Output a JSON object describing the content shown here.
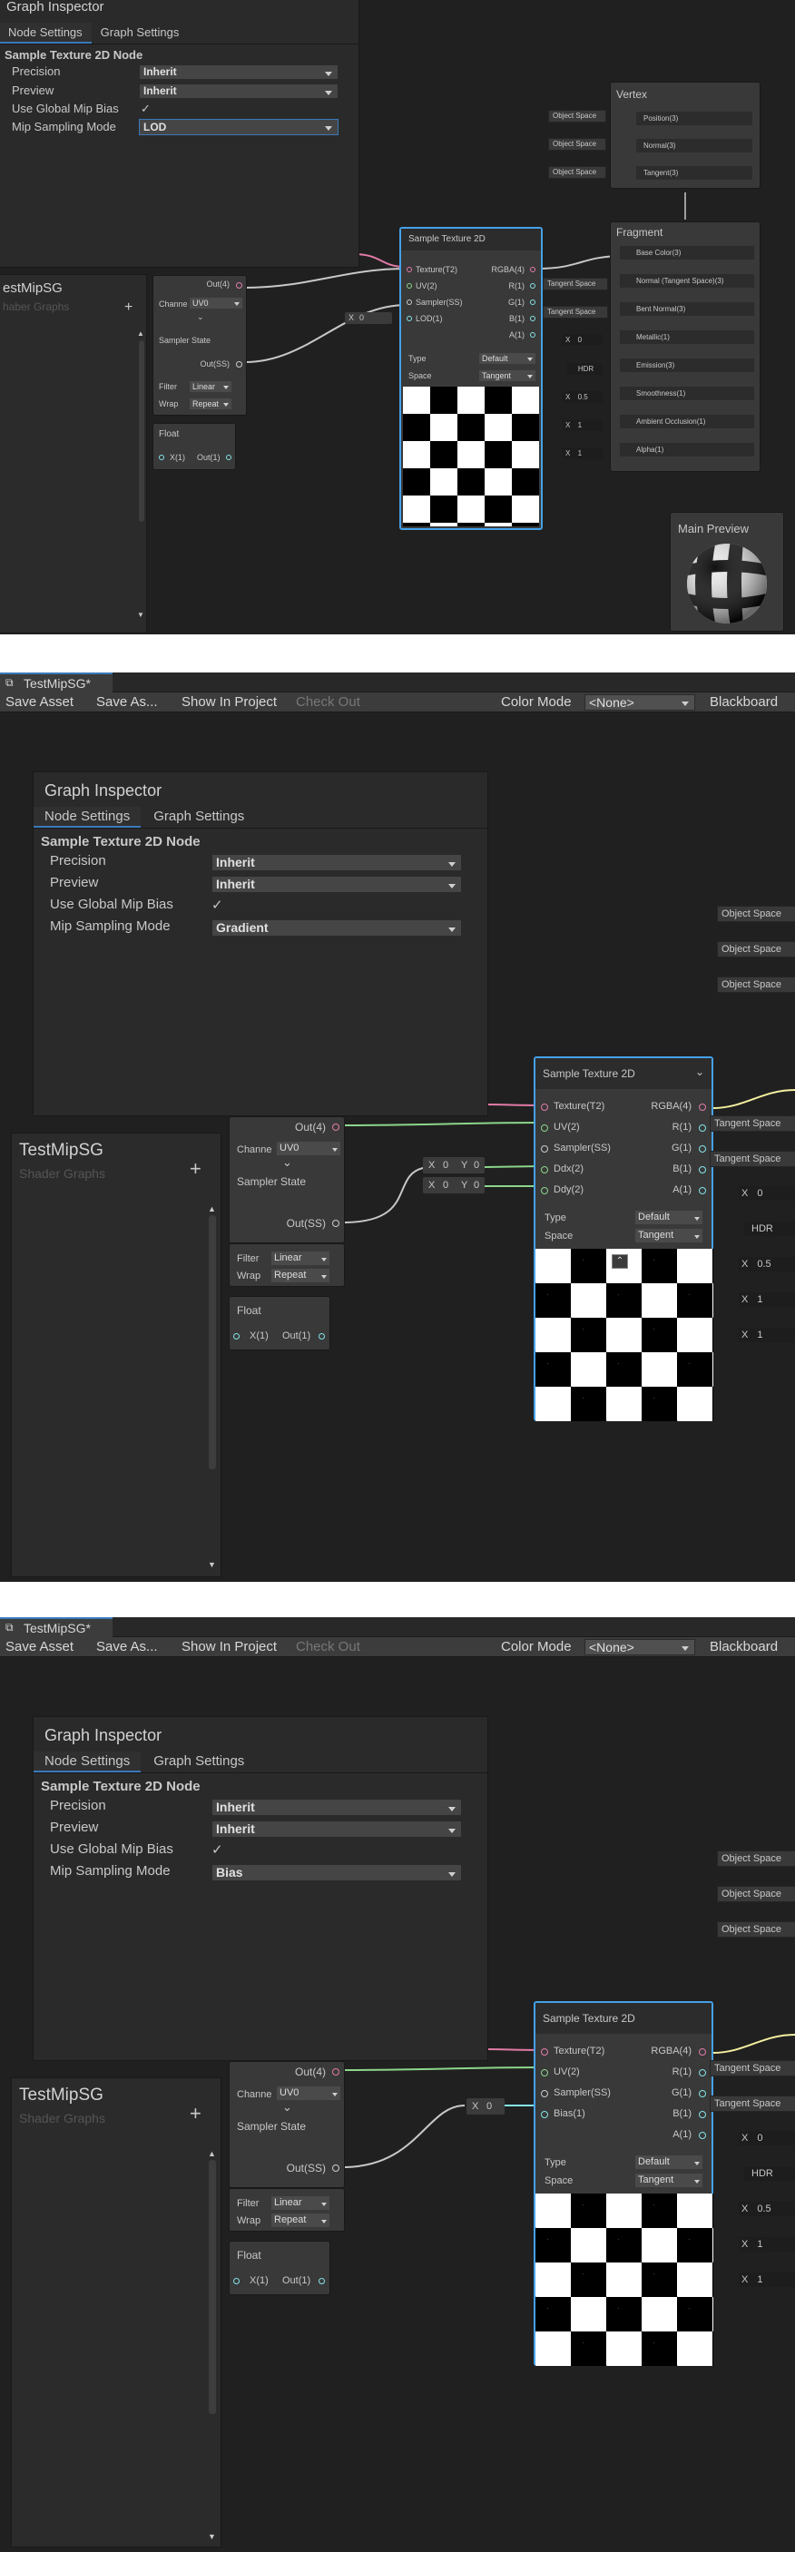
{
  "colors": {
    "bg": "#202020",
    "accent": "#3a79bb",
    "node_selected": "#45a1e8",
    "port_vec4": "#e27ba8",
    "port_vec2": "#8cd68c",
    "port_vec1": "#84e4e7",
    "port_color": "#f4f0a0"
  },
  "p1": {
    "inspector": {
      "title": "Graph Inspector",
      "tabs": [
        "Node Settings",
        "Graph Settings"
      ],
      "node_title": "Sample Texture 2D Node",
      "rows": [
        {
          "label": "Precision",
          "value": "Inherit"
        },
        {
          "label": "Preview",
          "value": "Inherit"
        },
        {
          "label": "Use Global Mip Bias",
          "value": "✓"
        },
        {
          "label": "Mip Sampling Mode",
          "value": "LOD"
        }
      ]
    },
    "blackboard": {
      "title": "estMipSG",
      "sub": "haber Graphs",
      "add": "+"
    },
    "uv_node": {
      "out": "Out(4)",
      "channel_label": "Channe",
      "channel_value": "UV0",
      "sampler_title": "Sampler State",
      "sampler_out": "Out(SS)",
      "filter_label": "Filter",
      "filter_value": "Linear",
      "wrap_label": "Wrap",
      "wrap_value": "Repeat"
    },
    "float_node": {
      "title": "Float",
      "in": "X(1)",
      "out": "Out(1)"
    },
    "lod_x": {
      "axis": "X",
      "value": "0"
    },
    "sample": {
      "title": "Sample Texture 2D",
      "inputs": [
        "Texture(T2)",
        "UV(2)",
        "Sampler(SS)",
        "LOD(1)"
      ],
      "outputs": [
        "RGBA(4)",
        "R(1)",
        "G(1)",
        "B(1)",
        "A(1)"
      ],
      "type_label": "Type",
      "type_value": "Default",
      "space_label": "Space",
      "space_value": "Tangent"
    },
    "vertex": {
      "title": "Vertex",
      "ports": [
        "Position(3)",
        "Normal(3)",
        "Tangent(3)"
      ],
      "spaces": [
        "Object Space",
        "Object Space",
        "Object Space"
      ]
    },
    "fragment": {
      "title": "Fragment",
      "ports": [
        "Base Color(3)",
        "Normal (Tangent Space)(3)",
        "Bent Normal(3)",
        "Metallic(1)",
        "Emission(3)",
        "Smoothness(1)",
        "Ambient Occlusion(1)",
        "Alpha(1)"
      ],
      "spaces": [
        "Tangent Space",
        "Tangent Space"
      ],
      "metallic": "0",
      "hdr": "HDR",
      "smooth": "0.5",
      "ao": "1",
      "alpha": "1",
      "x": "X"
    },
    "preview": {
      "title": "Main Preview"
    }
  },
  "p2": {
    "tab": "TestMipSG*",
    "toolbar": {
      "save": "Save Asset",
      "save_as": "Save As...",
      "show": "Show In Project",
      "checkout": "Check Out",
      "color_mode": "Color Mode",
      "none": "<None>",
      "blackboard": "Blackboard"
    },
    "inspector": {
      "title": "Graph Inspector",
      "tabs": [
        "Node Settings",
        "Graph Settings"
      ],
      "node_title": "Sample Texture 2D Node",
      "rows": [
        {
          "label": "Precision",
          "value": "Inherit"
        },
        {
          "label": "Preview",
          "value": "Inherit"
        },
        {
          "label": "Use Global Mip Bias",
          "value": "✓"
        },
        {
          "label": "Mip Sampling Mode",
          "value": "Gradient"
        }
      ]
    },
    "blackboard": {
      "title": "TestMipSG",
      "sub": "Shader Graphs",
      "add": "+"
    },
    "uv_node": {
      "out": "Out(4)",
      "channel_label": "Channe",
      "channel_value": "UV0",
      "sampler_title": "Sampler State",
      "sampler_out": "Out(SS)",
      "filter_label": "Filter",
      "filter_value": "Linear",
      "wrap_label": "Wrap",
      "wrap_value": "Repeat"
    },
    "float_node": {
      "title": "Float",
      "in": "X(1)",
      "out": "Out(1)"
    },
    "ddx": {
      "x": "X",
      "xv": "0",
      "y": "Y",
      "yv": "0"
    },
    "ddy": {
      "x": "X",
      "xv": "0",
      "y": "Y",
      "yv": "0"
    },
    "sample": {
      "title": "Sample Texture 2D",
      "inputs": [
        "Texture(T2)",
        "UV(2)",
        "Sampler(SS)",
        "Ddx(2)",
        "Ddy(2)"
      ],
      "outputs": [
        "RGBA(4)",
        "R(1)",
        "G(1)",
        "B(1)",
        "A(1)"
      ],
      "type_label": "Type",
      "type_value": "Default",
      "space_label": "Space",
      "space_value": "Tangent"
    },
    "right": {
      "objs": [
        "Object Space",
        "Object Space",
        "Object Space"
      ],
      "tangents": [
        "Tangent Space",
        "Tangent Space"
      ],
      "x": "X",
      "v1": "0",
      "hdr": "HDR",
      "v2": "0.5",
      "v3": "1",
      "v4": "1"
    }
  },
  "p3": {
    "tab": "TestMipSG*",
    "toolbar": {
      "save": "Save Asset",
      "save_as": "Save As...",
      "show": "Show In Project",
      "checkout": "Check Out",
      "color_mode": "Color Mode",
      "none": "<None>",
      "blackboard": "Blackboard"
    },
    "inspector": {
      "title": "Graph Inspector",
      "tabs": [
        "Node Settings",
        "Graph Settings"
      ],
      "node_title": "Sample Texture 2D Node",
      "rows": [
        {
          "label": "Precision",
          "value": "Inherit"
        },
        {
          "label": "Preview",
          "value": "Inherit"
        },
        {
          "label": "Use Global Mip Bias",
          "value": "✓"
        },
        {
          "label": "Mip Sampling Mode",
          "value": "Bias"
        }
      ]
    },
    "blackboard": {
      "title": "TestMipSG",
      "sub": "Shader Graphs",
      "add": "+"
    },
    "uv_node": {
      "out": "Out(4)",
      "channel_label": "Channe",
      "channel_value": "UV0",
      "sampler_title": "Sampler State",
      "sampler_out": "Out(SS)",
      "filter_label": "Filter",
      "filter_value": "Linear",
      "wrap_label": "Wrap",
      "wrap_value": "Repeat"
    },
    "float_node": {
      "title": "Float",
      "in": "X(1)",
      "out": "Out(1)"
    },
    "bias_x": {
      "axis": "X",
      "value": "0"
    },
    "sample": {
      "title": "Sample Texture 2D",
      "inputs": [
        "Texture(T2)",
        "UV(2)",
        "Sampler(SS)",
        "Bias(1)"
      ],
      "outputs": [
        "RGBA(4)",
        "R(1)",
        "G(1)",
        "B(1)",
        "A(1)"
      ],
      "type_label": "Type",
      "type_value": "Default",
      "space_label": "Space",
      "space_value": "Tangent"
    },
    "right": {
      "objs": [
        "Object Space",
        "Object Space",
        "Object Space"
      ],
      "tangents": [
        "Tangent Space",
        "Tangent Space"
      ],
      "x": "X",
      "v1": "0",
      "hdr": "HDR",
      "v2": "0.5",
      "v3": "1",
      "v4": "1"
    }
  }
}
